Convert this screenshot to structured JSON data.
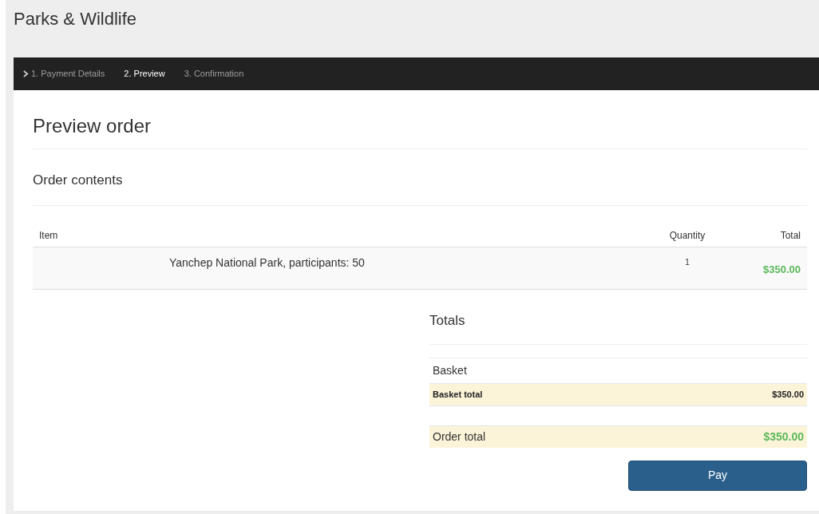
{
  "site_title": "Parks & Wildlife",
  "steps": [
    {
      "label": "1. Payment Details",
      "selected": false
    },
    {
      "label": "2. Preview",
      "selected": true
    },
    {
      "label": "3. Confirmation",
      "selected": false
    }
  ],
  "page_title": "Preview order",
  "section_title": "Order contents",
  "table": {
    "columns": [
      "Item",
      "Quantity",
      "Total"
    ],
    "rows": [
      {
        "item": "Yanchep National Park, participants: 50",
        "quantity": "1",
        "total": "$350.00"
      }
    ]
  },
  "totals": {
    "title": "Totals",
    "group": "Basket",
    "basket_total_label": "Basket total",
    "basket_total": "$350.00",
    "order_total_label": "Order total",
    "order_total": "$350.00"
  },
  "pay_button": "Pay"
}
